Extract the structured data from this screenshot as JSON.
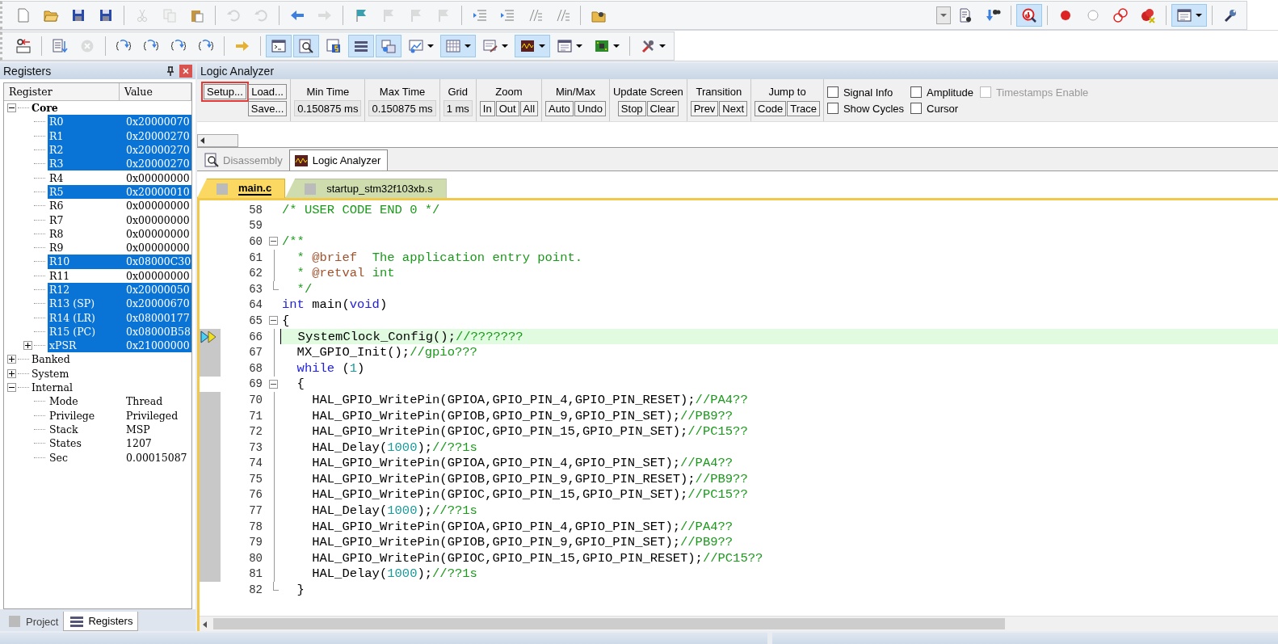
{
  "toolbar_main": [
    {
      "kind": "button",
      "disabled": false,
      "pressed": false
    },
    {
      "kind": "button",
      "disabled": false,
      "pressed": false
    },
    {
      "kind": "button",
      "disabled": false,
      "pressed": false
    },
    {
      "kind": "button",
      "disabled": false,
      "pressed": false
    },
    {
      "kind": "separator"
    },
    {
      "kind": "button",
      "disabled": true,
      "pressed": false
    },
    {
      "kind": "button",
      "disabled": true,
      "pressed": false
    },
    {
      "kind": "button",
      "disabled": false,
      "pressed": false
    },
    {
      "kind": "separator"
    },
    {
      "kind": "button",
      "disabled": true,
      "pressed": false
    },
    {
      "kind": "button",
      "disabled": true,
      "pressed": false
    },
    {
      "kind": "separator"
    },
    {
      "kind": "button",
      "disabled": false,
      "pressed": false
    },
    {
      "kind": "button",
      "disabled": true,
      "pressed": false
    },
    {
      "kind": "separator"
    },
    {
      "kind": "button",
      "disabled": false,
      "pressed": false
    },
    {
      "kind": "button",
      "disabled": true,
      "pressed": false
    },
    {
      "kind": "button",
      "disabled": true,
      "pressed": false
    },
    {
      "kind": "button",
      "disabled": true,
      "pressed": false
    },
    {
      "kind": "separator"
    },
    {
      "kind": "button",
      "disabled": false,
      "pressed": false
    },
    {
      "kind": "button",
      "disabled": false,
      "pressed": false
    },
    {
      "kind": "button",
      "disabled": false,
      "pressed": false
    },
    {
      "kind": "button",
      "disabled": false,
      "pressed": false
    },
    {
      "kind": "separator"
    },
    {
      "kind": "button",
      "disabled": false,
      "pressed": false
    },
    {
      "kind": "gap"
    },
    {
      "kind": "combo"
    },
    {
      "kind": "button",
      "disabled": false,
      "pressed": false
    },
    {
      "kind": "button",
      "disabled": false,
      "pressed": false
    },
    {
      "kind": "separator"
    },
    {
      "kind": "button",
      "disabled": false,
      "pressed": true
    },
    {
      "kind": "separator"
    },
    {
      "kind": "button",
      "disabled": false,
      "pressed": false
    },
    {
      "kind": "button",
      "disabled": false,
      "pressed": false
    },
    {
      "kind": "button",
      "disabled": false,
      "pressed": false
    },
    {
      "kind": "button",
      "disabled": false,
      "pressed": false
    },
    {
      "kind": "separator"
    },
    {
      "kind": "button",
      "disabled": false,
      "pressed": true,
      "dropdown": true
    },
    {
      "kind": "separator"
    },
    {
      "kind": "button",
      "disabled": false,
      "pressed": false
    }
  ],
  "toolbar_debug": [
    {
      "kind": "button",
      "disabled": false,
      "pressed": false
    },
    {
      "kind": "separator"
    },
    {
      "kind": "button",
      "disabled": false,
      "pressed": false
    },
    {
      "kind": "button",
      "disabled": true,
      "pressed": false
    },
    {
      "kind": "separator"
    },
    {
      "kind": "button",
      "disabled": false,
      "pressed": false
    },
    {
      "kind": "button",
      "disabled": false,
      "pressed": false
    },
    {
      "kind": "button",
      "disabled": false,
      "pressed": false
    },
    {
      "kind": "button",
      "disabled": false,
      "pressed": false
    },
    {
      "kind": "separator"
    },
    {
      "kind": "button",
      "disabled": false,
      "pressed": false
    },
    {
      "kind": "separator"
    },
    {
      "kind": "button",
      "disabled": false,
      "pressed": true
    },
    {
      "kind": "button",
      "disabled": false,
      "pressed": true
    },
    {
      "kind": "button",
      "disabled": false,
      "pressed": false
    },
    {
      "kind": "button",
      "disabled": false,
      "pressed": true
    },
    {
      "kind": "button",
      "disabled": false,
      "pressed": true
    },
    {
      "kind": "button",
      "disabled": false,
      "pressed": false,
      "dropdown": true
    },
    {
      "kind": "button",
      "disabled": false,
      "pressed": true,
      "dropdown": true
    },
    {
      "kind": "button",
      "disabled": false,
      "pressed": false,
      "dropdown": true
    },
    {
      "kind": "button",
      "disabled": false,
      "pressed": true,
      "dropdown": true
    },
    {
      "kind": "button",
      "disabled": false,
      "pressed": false,
      "dropdown": true
    },
    {
      "kind": "button",
      "disabled": false,
      "pressed": false,
      "dropdown": true
    },
    {
      "kind": "separator"
    },
    {
      "kind": "button",
      "disabled": false,
      "pressed": false,
      "dropdown": true
    }
  ],
  "registers_panel": {
    "title": "Registers",
    "columns": [
      "Register",
      "Value"
    ],
    "tree": [
      {
        "name": "Core",
        "expanded": true,
        "children": [
          {
            "name": "R0",
            "value": "0x20000070",
            "selected": true
          },
          {
            "name": "R1",
            "value": "0x20000270",
            "selected": true
          },
          {
            "name": "R2",
            "value": "0x20000270",
            "selected": true
          },
          {
            "name": "R3",
            "value": "0x20000270",
            "selected": true
          },
          {
            "name": "R4",
            "value": "0x00000000",
            "selected": false
          },
          {
            "name": "R5",
            "value": "0x20000010",
            "selected": true
          },
          {
            "name": "R6",
            "value": "0x00000000",
            "selected": false
          },
          {
            "name": "R7",
            "value": "0x00000000",
            "selected": false
          },
          {
            "name": "R8",
            "value": "0x00000000",
            "selected": false
          },
          {
            "name": "R9",
            "value": "0x00000000",
            "selected": false
          },
          {
            "name": "R10",
            "value": "0x08000C30",
            "selected": true
          },
          {
            "name": "R11",
            "value": "0x00000000",
            "selected": false
          },
          {
            "name": "R12",
            "value": "0x20000050",
            "selected": true
          },
          {
            "name": "R13 (SP)",
            "value": "0x20000670",
            "selected": true
          },
          {
            "name": "R14 (LR)",
            "value": "0x08000177",
            "selected": true
          },
          {
            "name": "R15 (PC)",
            "value": "0x08000B58",
            "selected": true
          },
          {
            "name": "xPSR",
            "value": "0x21000000",
            "selected": true,
            "expanded": false
          }
        ]
      },
      {
        "name": "Banked",
        "expanded": false
      },
      {
        "name": "System",
        "expanded": false
      },
      {
        "name": "Internal",
        "expanded": true,
        "children": [
          {
            "name": "Mode",
            "value": "Thread",
            "selected": false
          },
          {
            "name": "Privilege",
            "value": "Privileged",
            "selected": false
          },
          {
            "name": "Stack",
            "value": "MSP",
            "selected": false
          },
          {
            "name": "States",
            "value": "1207",
            "selected": false
          },
          {
            "name": "Sec",
            "value": "0.00015087",
            "selected": false
          }
        ]
      }
    ],
    "bottom_tabs": [
      {
        "label": "Project",
        "selected": false
      },
      {
        "label": "Registers",
        "selected": true
      }
    ]
  },
  "logic_analyzer": {
    "title": "Logic Analyzer",
    "file_buttons": [
      {
        "label": "Setup...",
        "outlined": true
      },
      {
        "label": "Load...",
        "outlined": false
      },
      {
        "label": "Save...",
        "outlined": false
      }
    ],
    "fields": [
      {
        "label": "Min Time",
        "value": "0.150875 ms"
      },
      {
        "label": "Max Time",
        "value": "0.150875 ms"
      },
      {
        "label": "Grid",
        "value": "1 ms"
      }
    ],
    "groups": [
      {
        "label": "Zoom",
        "buttons": [
          "In",
          "Out",
          "All"
        ]
      },
      {
        "label": "Min/Max",
        "buttons": [
          "Auto",
          "Undo"
        ]
      },
      {
        "label": "Update Screen",
        "buttons": [
          "Stop",
          "Clear"
        ]
      },
      {
        "label": "Transition",
        "buttons": [
          "Prev",
          "Next"
        ]
      },
      {
        "label": "Jump to",
        "buttons": [
          "Code",
          "Trace"
        ]
      }
    ],
    "checkboxes": [
      {
        "label": "Signal Info",
        "checked": false,
        "disabled": false
      },
      {
        "label": "Show Cycles",
        "checked": false,
        "disabled": false
      },
      {
        "label": "Amplitude",
        "checked": false,
        "disabled": false
      },
      {
        "label": "Cursor",
        "checked": false,
        "disabled": false
      },
      {
        "label": "Timestamps Enable",
        "checked": false,
        "disabled": true
      }
    ]
  },
  "view_tabs": [
    {
      "label": "Disassembly",
      "selected": false
    },
    {
      "label": "Logic Analyzer",
      "selected": true
    }
  ],
  "file_tabs": [
    {
      "label": "main.c",
      "selected": true
    },
    {
      "label": "startup_stm32f103xb.s",
      "selected": false
    }
  ],
  "code": [
    {
      "number": "58",
      "executable": false,
      "current": false,
      "segments": [
        {
          "kind": "comment",
          "text": "/* USER CODE END 0 */"
        }
      ]
    },
    {
      "number": "59",
      "executable": false,
      "current": false
    },
    {
      "number": "60",
      "executable": false,
      "current": false,
      "foldable": true,
      "segments": [
        {
          "kind": "comment",
          "text": "/**"
        }
      ]
    },
    {
      "number": "61",
      "executable": false,
      "current": false,
      "segments": [
        {
          "kind": "comment",
          "text": "  * "
        },
        {
          "kind": "doctag",
          "text": "@brief"
        },
        {
          "kind": "comment",
          "text": "  The application entry point."
        }
      ]
    },
    {
      "number": "62",
      "executable": false,
      "current": false,
      "segments": [
        {
          "kind": "comment",
          "text": "  * "
        },
        {
          "kind": "doctag",
          "text": "@retval"
        },
        {
          "kind": "comment",
          "text": " int"
        }
      ]
    },
    {
      "number": "63",
      "executable": false,
      "current": false,
      "fold_end": true,
      "segments": [
        {
          "kind": "comment",
          "text": "  */"
        }
      ]
    },
    {
      "number": "64",
      "executable": false,
      "current": false,
      "segments": [
        {
          "kind": "keyword",
          "text": "int"
        },
        {
          "kind": "plain",
          "text": " main("
        },
        {
          "kind": "keyword",
          "text": "void"
        },
        {
          "kind": "plain",
          "text": ")"
        }
      ]
    },
    {
      "number": "65",
      "executable": false,
      "current": false,
      "foldable": true,
      "segments": [
        {
          "kind": "plain",
          "text": "{"
        }
      ]
    },
    {
      "number": "66",
      "executable": true,
      "current": true,
      "segments": [
        {
          "kind": "plain",
          "text": "  SystemClock_Config();"
        },
        {
          "kind": "comment",
          "text": "//???????"
        }
      ]
    },
    {
      "number": "67",
      "executable": true,
      "current": false,
      "segments": [
        {
          "kind": "plain",
          "text": "  MX_GPIO_Init();"
        },
        {
          "kind": "comment",
          "text": "//gpio???"
        }
      ]
    },
    {
      "number": "68",
      "executable": true,
      "current": false,
      "segments": [
        {
          "kind": "keyword",
          "text": "  while"
        },
        {
          "kind": "plain",
          "text": " ("
        },
        {
          "kind": "number",
          "text": "1"
        },
        {
          "kind": "plain",
          "text": ")"
        }
      ]
    },
    {
      "number": "69",
      "executable": false,
      "current": false,
      "foldable": true,
      "segments": [
        {
          "kind": "plain",
          "text": "  {"
        }
      ]
    },
    {
      "number": "70",
      "executable": true,
      "current": false,
      "segments": [
        {
          "kind": "plain",
          "text": "    HAL_GPIO_WritePin(GPIOA,GPIO_PIN_4,GPIO_PIN_RESET);"
        },
        {
          "kind": "comment",
          "text": "//PA4??"
        }
      ]
    },
    {
      "number": "71",
      "executable": true,
      "current": false,
      "segments": [
        {
          "kind": "plain",
          "text": "    HAL_GPIO_WritePin(GPIOB,GPIO_PIN_9,GPIO_PIN_SET);"
        },
        {
          "kind": "comment",
          "text": "//PB9??"
        }
      ]
    },
    {
      "number": "72",
      "executable": true,
      "current": false,
      "segments": [
        {
          "kind": "plain",
          "text": "    HAL_GPIO_WritePin(GPIOC,GPIO_PIN_15,GPIO_PIN_SET);"
        },
        {
          "kind": "comment",
          "text": "//PC15??"
        }
      ]
    },
    {
      "number": "73",
      "executable": true,
      "current": false,
      "segments": [
        {
          "kind": "plain",
          "text": "    HAL_Delay("
        },
        {
          "kind": "number",
          "text": "1000"
        },
        {
          "kind": "plain",
          "text": ");"
        },
        {
          "kind": "comment",
          "text": "//??1s"
        }
      ]
    },
    {
      "number": "74",
      "executable": true,
      "current": false,
      "segments": [
        {
          "kind": "plain",
          "text": "    HAL_GPIO_WritePin(GPIOA,GPIO_PIN_4,GPIO_PIN_SET);"
        },
        {
          "kind": "comment",
          "text": "//PA4??"
        }
      ]
    },
    {
      "number": "75",
      "executable": true,
      "current": false,
      "segments": [
        {
          "kind": "plain",
          "text": "    HAL_GPIO_WritePin(GPIOB,GPIO_PIN_9,GPIO_PIN_RESET);"
        },
        {
          "kind": "comment",
          "text": "//PB9??"
        }
      ]
    },
    {
      "number": "76",
      "executable": true,
      "current": false,
      "segments": [
        {
          "kind": "plain",
          "text": "    HAL_GPIO_WritePin(GPIOC,GPIO_PIN_15,GPIO_PIN_SET);"
        },
        {
          "kind": "comment",
          "text": "//PC15??"
        }
      ]
    },
    {
      "number": "77",
      "executable": true,
      "current": false,
      "segments": [
        {
          "kind": "plain",
          "text": "    HAL_Delay("
        },
        {
          "kind": "number",
          "text": "1000"
        },
        {
          "kind": "plain",
          "text": ");"
        },
        {
          "kind": "comment",
          "text": "//??1s"
        }
      ]
    },
    {
      "number": "78",
      "executable": true,
      "current": false,
      "segments": [
        {
          "kind": "plain",
          "text": "    HAL_GPIO_WritePin(GPIOA,GPIO_PIN_4,GPIO_PIN_SET);"
        },
        {
          "kind": "comment",
          "text": "//PA4??"
        }
      ]
    },
    {
      "number": "79",
      "executable": true,
      "current": false,
      "segments": [
        {
          "kind": "plain",
          "text": "    HAL_GPIO_WritePin(GPIOB,GPIO_PIN_9,GPIO_PIN_SET);"
        },
        {
          "kind": "comment",
          "text": "//PB9??"
        }
      ]
    },
    {
      "number": "80",
      "executable": true,
      "current": false,
      "segments": [
        {
          "kind": "plain",
          "text": "    HAL_GPIO_WritePin(GPIOC,GPIO_PIN_15,GPIO_PIN_RESET);"
        },
        {
          "kind": "comment",
          "text": "//PC15??"
        }
      ]
    },
    {
      "number": "81",
      "executable": true,
      "current": false,
      "segments": [
        {
          "kind": "plain",
          "text": "    HAL_Delay("
        },
        {
          "kind": "number",
          "text": "1000"
        },
        {
          "kind": "plain",
          "text": ");"
        },
        {
          "kind": "comment",
          "text": "//??1s"
        }
      ]
    },
    {
      "number": "82",
      "executable": false,
      "current": false,
      "fold_end": true,
      "segments": [
        {
          "kind": "plain",
          "text": "  }"
        }
      ]
    }
  ]
}
